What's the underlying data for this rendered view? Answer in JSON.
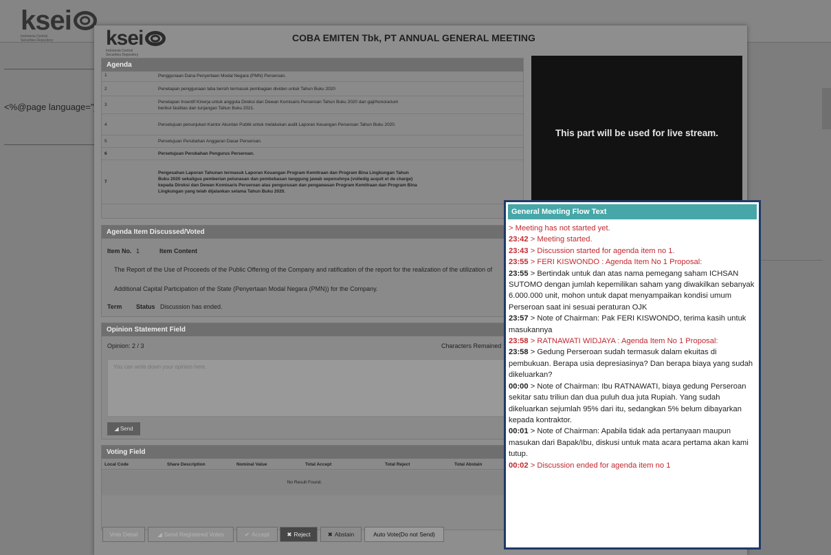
{
  "background": {
    "logo_text": "ksei",
    "logo_subtitle_1": "Indonesia Central",
    "logo_subtitle_2": "Securities Depository",
    "code_text": "<%@page language=\"ja"
  },
  "modal": {
    "logo_text": "ksei",
    "logo_subtitle_1": "Indonesia Central",
    "logo_subtitle_2": "Securities Depository",
    "title": "COBA EMITEN Tbk, PT ANNUAL GENERAL MEETING"
  },
  "agenda": {
    "header": "Agenda",
    "items": [
      {
        "no": "1",
        "text": "Penggunaan Dana Penyertaan Modal Negara (PMN) Perseroan."
      },
      {
        "no": "2",
        "text": "Penetapan penggunaan laba bersih termasuk pembagian dividen untuk Tahun Buku 2020"
      },
      {
        "no": "3",
        "text": "Penetapan Insentif Kinerja untuk anggota Direksi dan Dewan Komisaris Perseroan Tahun Buku 2020 dan gaji/honorarium berikut fasilitas dan tunjangan Tahun Buku 2021."
      },
      {
        "no": "4",
        "text": "Persetujuan penunjukan Kantor Akuntan Publik untuk melakukan audit Laporan Keuangan Perseroan Tahun Buku 2020."
      },
      {
        "no": "5",
        "text": "Persetujuan Perubahan Anggaran Dasar Perseroan."
      },
      {
        "no": "6",
        "text": "Persetujuan Perubahan Pengurus Perseroan."
      },
      {
        "no": "7",
        "text": "Pengesahan Laporan Tahunan termasuk Laporan Keuangan Program Kemitraan dan Program Bina Lingkungan Tahun Buku 2020 sekaligus pemberian pelunasan dan pembebasan tanggung jawab sepenuhnya (volledig acquit et de charge) kepada Direksi dan Dewan Komisaris Perseroan atas pengurusan dan pengawasan Program Kemitraan dan Program Bina Lingkungan yang telah dijalankan selama Tahun Buku 2020."
      }
    ]
  },
  "stream": {
    "text": "This part will be used for live stream."
  },
  "discussed": {
    "header": "Agenda Item Discussed/Voted",
    "item_no_label": "Item No.",
    "item_no_value": "1",
    "item_content_label": "Item Content",
    "content_line_1": "The Report of the Use of Proceeds of the Public Offering of the Company and ratification of the report for the realization of the utilization of",
    "content_line_2": "Additional Capital Participation of the State (Penyertaan Modal Negara (PMN)) for the Company.",
    "term_label": "Term",
    "status_label": "Status",
    "status_value": "Discussion has ended."
  },
  "opinion": {
    "header": "Opinion Statement Field",
    "count": "Opinion: 2 / 3",
    "remaining": "Characters Remained :",
    "placeholder": "You can write down your opinion here.",
    "send_label": "Send"
  },
  "voting": {
    "header": "Voting Field",
    "columns": [
      "Local Code",
      "Share Description",
      "Nominal Value",
      "Total Accept",
      "Total Reject",
      "Total Abstain"
    ],
    "empty_text": "No Result Found."
  },
  "buttons": {
    "vote_detail": "Vote Detail",
    "send_registered": "Send Registered Votes",
    "accept": "Accept",
    "reject": "Reject",
    "abstain": "Abstain",
    "auto_vote": "Auto Vote(Do not Send)"
  },
  "flow": {
    "header": "General Meeting Flow Text",
    "lines": [
      {
        "time": "",
        "text": "> Meeting has not started yet.",
        "style": "red"
      },
      {
        "time": "23:42",
        "text": " > Meeting started.",
        "style": "red"
      },
      {
        "time": "23:43",
        "text": " > Discussion started for agenda item no 1.",
        "style": "red"
      },
      {
        "time": "23:55",
        "text": " > FERI KISWONDO : Agenda Item No 1 Proposal:",
        "style": "red"
      },
      {
        "time": "23:55",
        "text": " > Bertindak untuk dan atas nama pemegang saham ICHSAN SUTOMO dengan jumlah kepemilikan saham yang diwakilkan sebanyak 6.000.000 unit, mohon untuk dapat menyampaikan kondisi umum Perseroan saat ini sesuai peraturan OJK",
        "style": "black"
      },
      {
        "time": "23:57",
        "text": " > Note of Chairman: Pak FERI KISWONDO, terima kasih untuk masukannya",
        "style": "black"
      },
      {
        "time": "23:58",
        "text": " > RATNAWATI WIDJAYA : Agenda Item No 1 Proposal:",
        "style": "red"
      },
      {
        "time": "23:58",
        "text": " > Gedung Perseroan sudah termasuk dalam ekuitas di pembukuan. Berapa usia depresiasinya? Dan berapa biaya yang sudah dikeluarkan?",
        "style": "black"
      },
      {
        "time": "00:00",
        "text": " > Note of Chairman: Ibu RATNAWATI, biaya gedung Perseroan sekitar satu triliun dan dua puluh dua juta Rupiah. Yang sudah dikeluarkan sejumlah 95% dari itu, sedangkan 5% belum dibayarkan kepada kontraktor.",
        "style": "black"
      },
      {
        "time": "00:01",
        "text": " > Note of Chairman: Apabila tidak ada pertanyaan maupun masukan dari Bapak/Ibu, diskusi untuk mata acara pertama akan kami tutup.",
        "style": "black"
      },
      {
        "time": "00:02",
        "text": " > Discussion ended for agenda item no 1",
        "style": "red"
      }
    ]
  }
}
